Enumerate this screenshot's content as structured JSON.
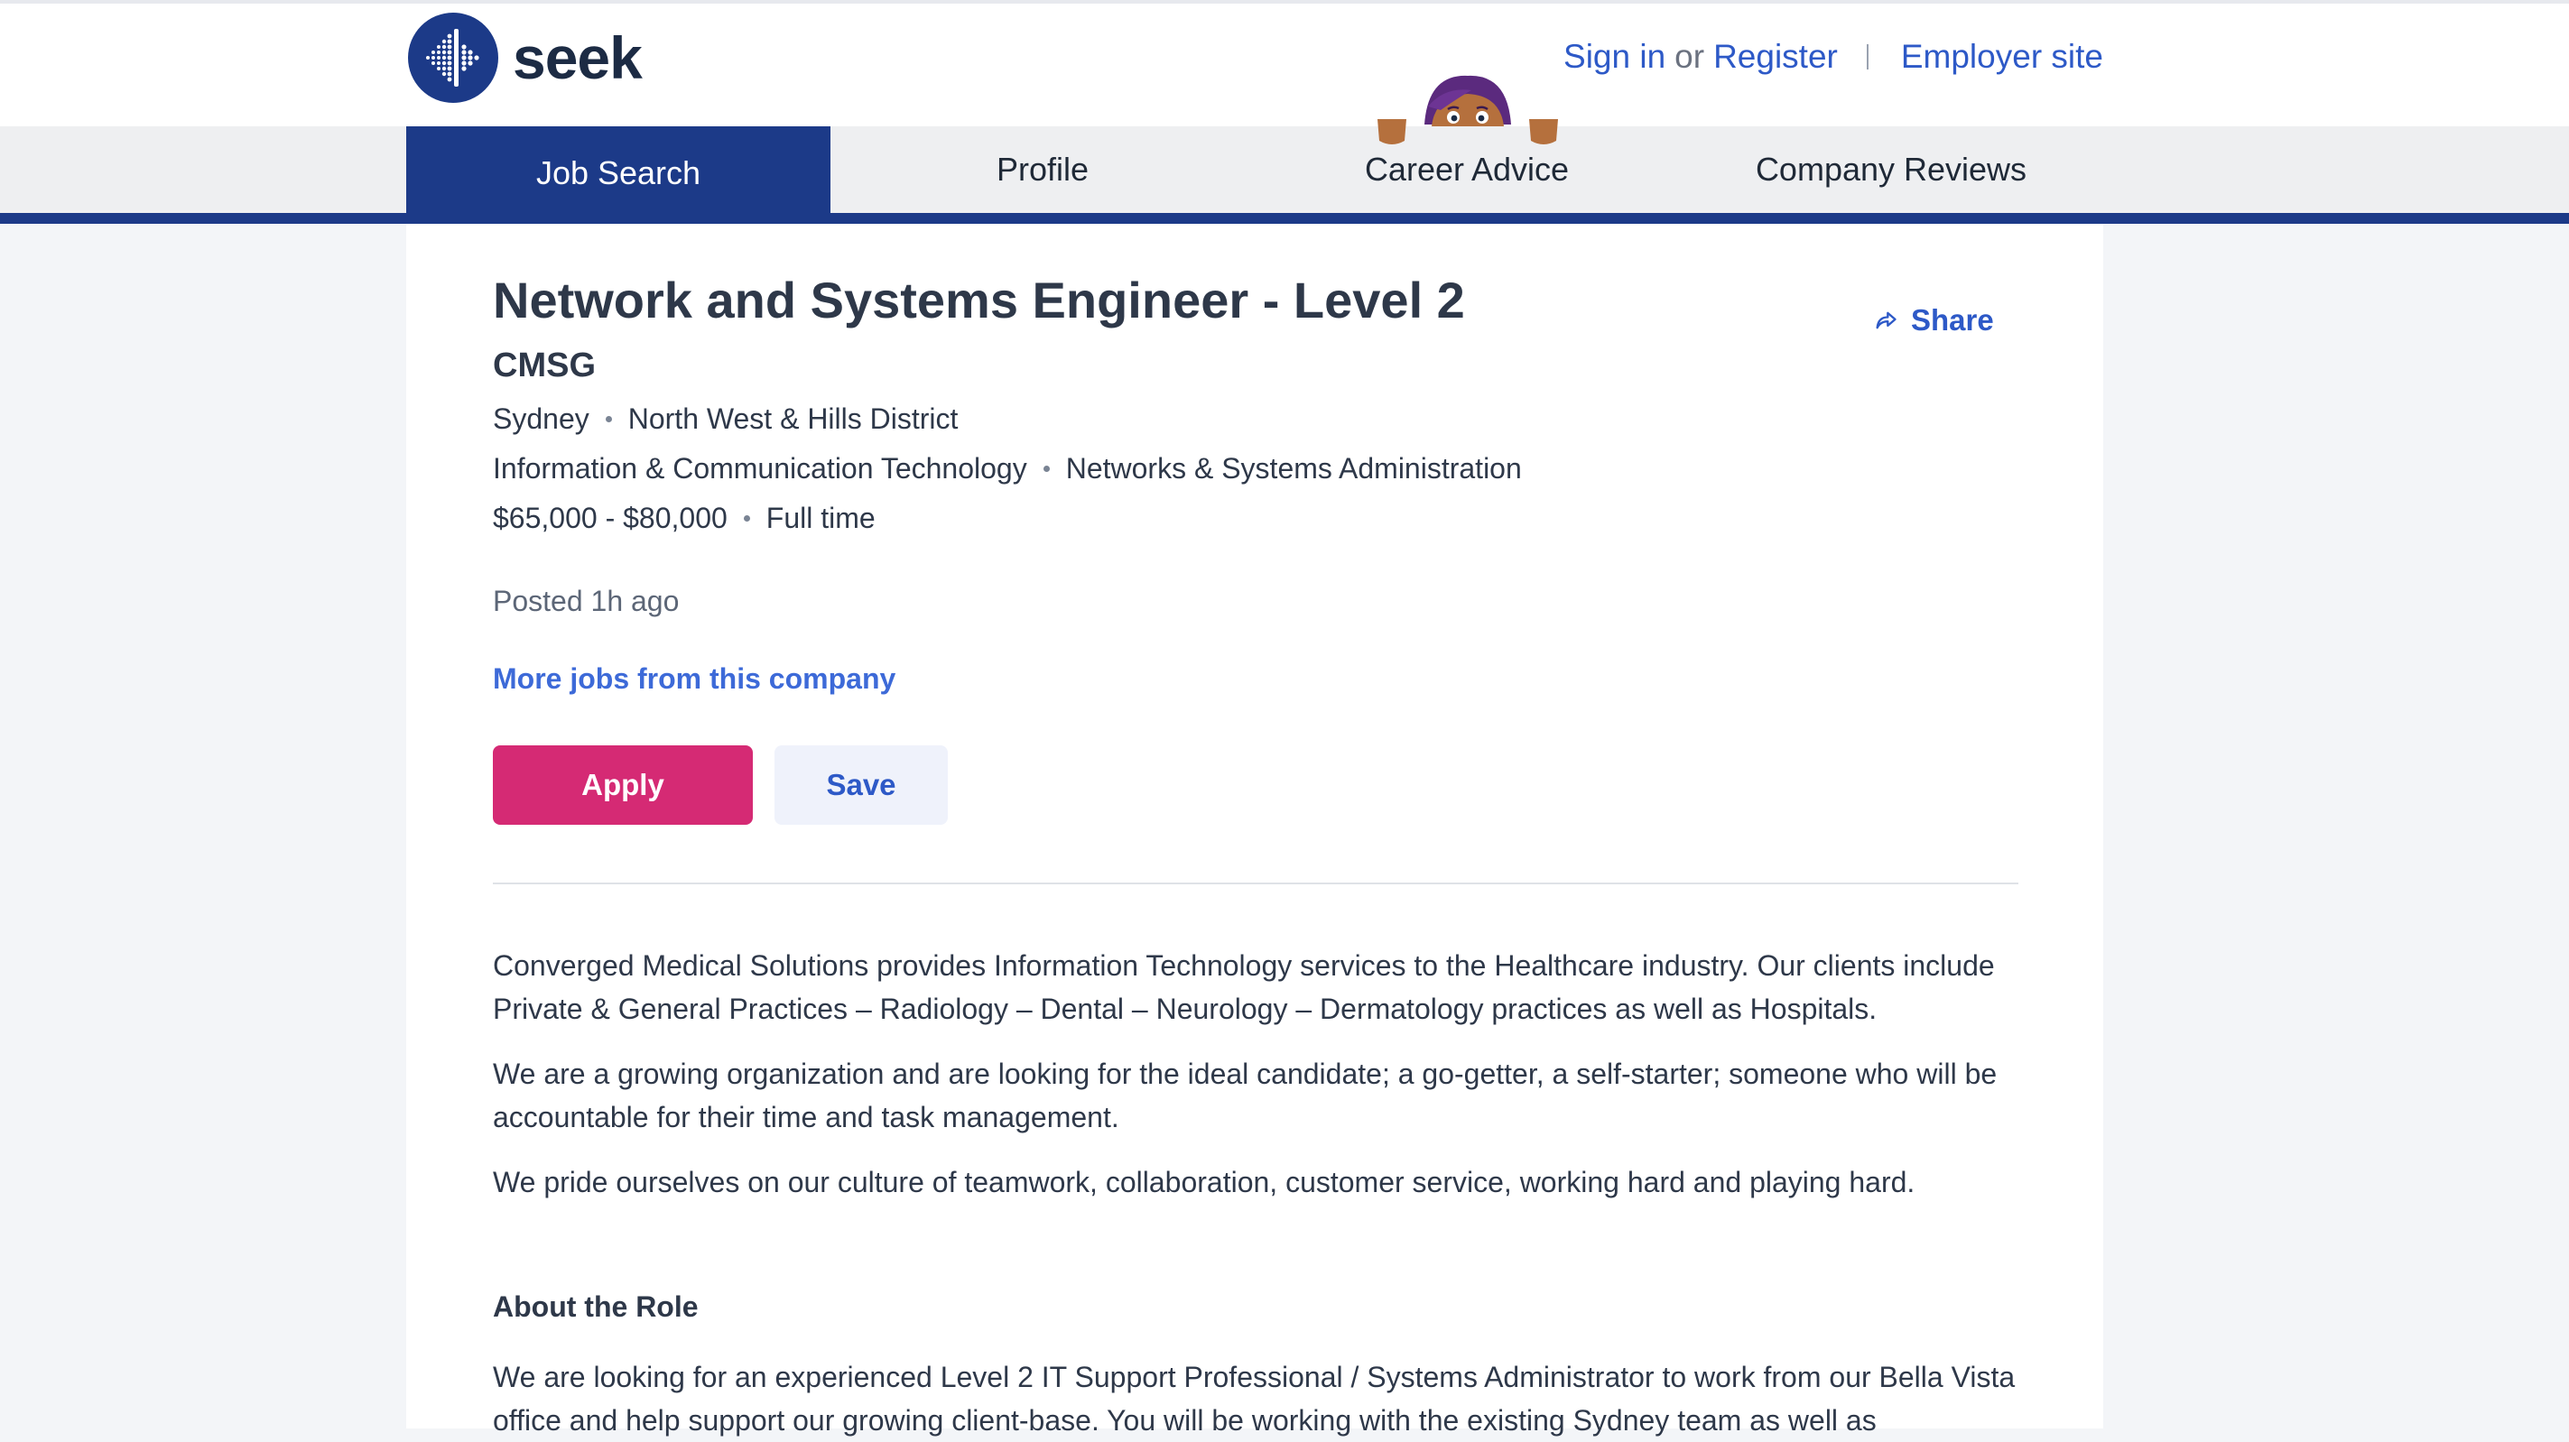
{
  "header": {
    "brand": "seek",
    "sign_in": "Sign in",
    "or": "or",
    "register": "Register",
    "employer_site": "Employer site"
  },
  "nav": {
    "tabs": [
      {
        "label": "Job Search",
        "active": true
      },
      {
        "label": "Profile",
        "active": false
      },
      {
        "label": "Career Advice",
        "active": false
      },
      {
        "label": "Company Reviews",
        "active": false
      }
    ]
  },
  "job": {
    "title": "Network and Systems Engineer - Level 2",
    "company": "CMSG",
    "location": "Sydney",
    "area": "North West & Hills District",
    "classification": "Information & Communication Technology",
    "subclassification": "Networks & Systems Administration",
    "salary": "$65,000 - $80,000",
    "work_type": "Full time",
    "posted": "Posted 1h ago",
    "more_jobs": "More jobs from this company",
    "share": "Share",
    "apply": "Apply",
    "save": "Save"
  },
  "description": {
    "paragraphs": [
      "Converged Medical Solutions provides Information Technology services to the Healthcare industry. Our clients include Private & General Practices – Radiology – Dental – Neurology – Dermatology practices as well as Hospitals.",
      "We are a growing organization and are looking for the ideal candidate; a go-getter, a self-starter; someone who will be accountable for their time and task management.",
      "We pride ourselves on our culture of teamwork, collaboration, customer service, working hard and playing hard."
    ],
    "about_heading": "About the Role",
    "about_text": "We are looking for an experienced Level 2 IT Support Professional / Systems Administrator to work from our Bella Vista office and help support our growing client-base.  You will be working with the existing Sydney team as well as"
  },
  "colors": {
    "brand_navy": "#1c3a88",
    "link_blue": "#2d59c7",
    "apply_pink": "#d52a74"
  }
}
